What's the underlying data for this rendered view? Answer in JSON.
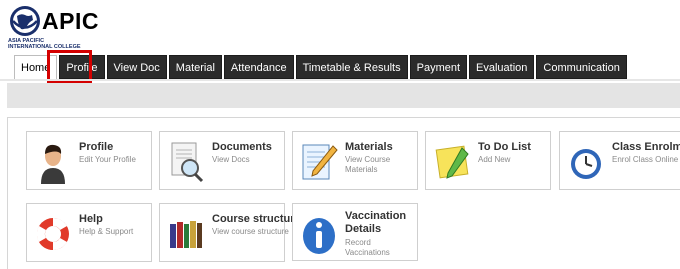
{
  "logo": {
    "name": "APIC",
    "subtitle_line1": "ASIA PACIFIC",
    "subtitle_line2": "INTERNATIONAL COLLEGE"
  },
  "tabs": [
    {
      "label": "Home",
      "active": true
    },
    {
      "label": "Profile",
      "highlighted": true
    },
    {
      "label": "View Doc"
    },
    {
      "label": "Material"
    },
    {
      "label": "Attendance"
    },
    {
      "label": "Timetable & Results"
    },
    {
      "label": "Payment"
    },
    {
      "label": "Evaluation"
    },
    {
      "label": "Communication"
    }
  ],
  "cards": [
    {
      "title": "Profile",
      "subtitle": "Edit Your Profile",
      "icon": "user-icon"
    },
    {
      "title": "Documents",
      "subtitle": "View Docs",
      "icon": "document-search-icon"
    },
    {
      "title": "Materials",
      "subtitle": "View Course Materials",
      "icon": "notepad-pencil-icon"
    },
    {
      "title": "To Do List",
      "subtitle": "Add New",
      "icon": "sticky-note-icon"
    },
    {
      "title": "Class Enrolment",
      "subtitle": "Enrol Class Online",
      "icon": "clock-icon"
    },
    {
      "title": "Help",
      "subtitle": "Help & Support",
      "icon": "lifebuoy-icon"
    },
    {
      "title": "Course structure",
      "subtitle": "View course structure",
      "icon": "books-icon"
    },
    {
      "title": "Vaccination Details",
      "subtitle": "Record Vaccinations",
      "icon": "info-icon"
    }
  ],
  "colors": {
    "tab_bg": "#2b2b2b",
    "highlight": "#d40000",
    "brand_blue": "#1a2f6b"
  }
}
